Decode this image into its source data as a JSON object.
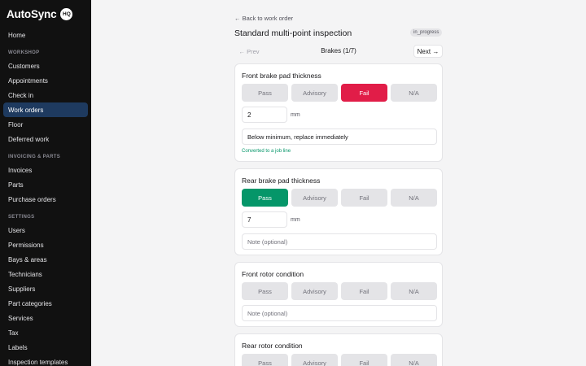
{
  "app": {
    "name": "AutoSync",
    "badge": "HQ"
  },
  "sidebar": {
    "home": "Home",
    "sections": [
      {
        "label": "WORKSHOP",
        "items": [
          "Customers",
          "Appointments",
          "Check in",
          "Work orders",
          "Floor",
          "Deferred work"
        ]
      },
      {
        "label": "INVOICING & PARTS",
        "items": [
          "Invoices",
          "Parts",
          "Purchase orders"
        ]
      },
      {
        "label": "SETTINGS",
        "items": [
          "Users",
          "Permissions",
          "Bays & areas",
          "Technicians",
          "Suppliers",
          "Part categories",
          "Services",
          "Tax",
          "Labels",
          "Inspection templates"
        ]
      }
    ],
    "active_item": "Work orders"
  },
  "header": {
    "back_label": "← Back to work order",
    "title": "Standard multi-point inspection",
    "status": "in_progress"
  },
  "pager": {
    "prev_label": "← Prev",
    "section_label": "Brakes (1/7)",
    "next_label": "Next →"
  },
  "options": [
    "Pass",
    "Advisory",
    "Fail",
    "N/A"
  ],
  "items": [
    {
      "title": "Front brake pad thickness",
      "selected": "Fail",
      "measurement": "2",
      "unit": "mm",
      "note": "Below minimum, replace immediately",
      "note_placeholder": "Note (optional)",
      "converted_label": "Converted to a job line"
    },
    {
      "title": "Rear brake pad thickness",
      "selected": "Pass",
      "measurement": "7",
      "unit": "mm",
      "note": "",
      "note_placeholder": "Note (optional)"
    },
    {
      "title": "Front rotor condition",
      "selected": "",
      "note": "",
      "note_placeholder": "Note (optional)"
    },
    {
      "title": "Rear rotor condition",
      "selected": "",
      "note": "",
      "note_placeholder": "Note (optional)"
    }
  ],
  "colors": {
    "sidebar_bg": "#111111",
    "active_nav": "#1e3a5f",
    "fail": "#e11d48",
    "pass": "#059669"
  }
}
